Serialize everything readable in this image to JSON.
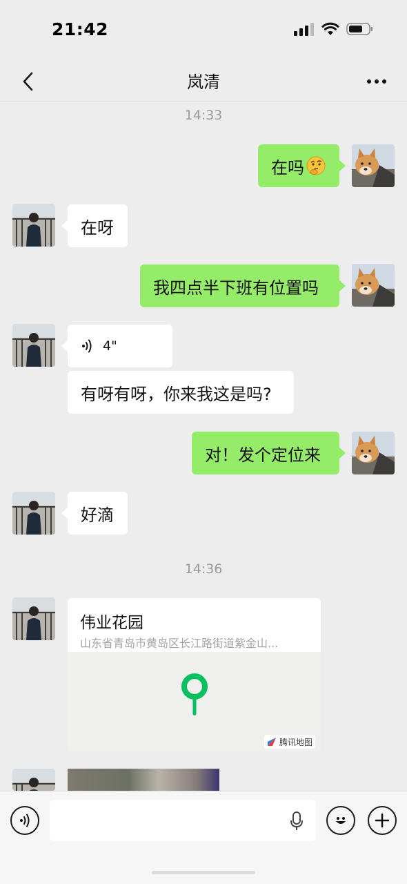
{
  "status_bar": {
    "time": "21:42"
  },
  "header": {
    "title": "岚清"
  },
  "messages": {
    "time1": "14:33",
    "m1": "在吗",
    "m2": "在呀",
    "m3": "我四点半下班有位置吗",
    "voice_duration": "4\"",
    "m4": "有呀有呀，你来我这是吗?",
    "m5": "对！发个定位来",
    "m6": "好滴",
    "time2": "14:36"
  },
  "location": {
    "title": "伟业花园",
    "address": "山东省青岛市黄岛区长江路街道紫金山...",
    "map_brand": "腾讯地图"
  },
  "colors": {
    "sent_bubble": "#95ec69",
    "received_bubble": "#ffffff",
    "background": "#ededed",
    "map_pin": "#07c160"
  }
}
